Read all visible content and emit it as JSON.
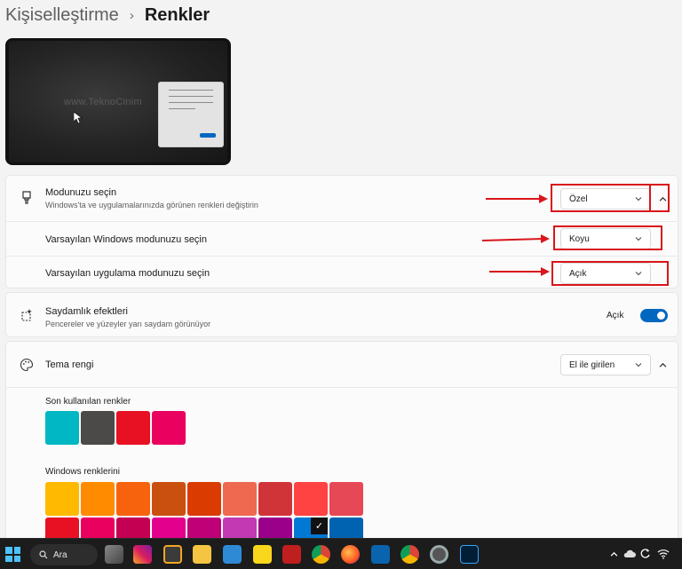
{
  "breadcrumb": {
    "parent": "Kişiselleştirme",
    "separator": "›",
    "current": "Renkler"
  },
  "preview": {
    "watermark": "www.TeknoCinim"
  },
  "mode_card": {
    "main": {
      "title": "Modunuzu seçin",
      "subtitle": "Windows'ta ve uygulamalarınızda görünen renkleri değiştirin",
      "value": "Özel",
      "icon": "paintbrush-icon"
    },
    "windows_mode": {
      "title": "Varsayılan Windows modunuzu seçin",
      "value": "Koyu"
    },
    "app_mode": {
      "title": "Varsayılan uygulama modunuzu seçin",
      "value": "Açık"
    }
  },
  "transparency": {
    "title": "Saydamlık efektleri",
    "subtitle": "Pencereler ve yüzeyler yarı saydam görünüyor",
    "toggle_label": "Açık",
    "on": true,
    "icon": "transparency-icon"
  },
  "accent": {
    "title": "Tema rengi",
    "value": "El ile girilen",
    "icon": "palette-icon",
    "recent_label": "Son kullanılan renkler",
    "recent_colors": [
      "#00b7c3",
      "#4c4a48",
      "#e81123",
      "#ea005e"
    ],
    "windows_label": "Windows renklerini",
    "windows_colors_row1": [
      "#ffb900",
      "#ff8c00",
      "#f7630c",
      "#ca5010",
      "#da3b01",
      "#ef6950",
      "#d13438",
      "#ff4343",
      "#e74856"
    ],
    "windows_colors_row2": [
      "#e81123",
      "#ea005e",
      "#c30052",
      "#e3008c",
      "#bf0077",
      "#c239b3",
      "#9a0089",
      "#0078d4",
      "#0063b1"
    ],
    "selected_index_row2": 7
  },
  "taskbar": {
    "search_label": "Ara",
    "apps": [
      "task-view-icon",
      "instagram-icon",
      "sublime-icon",
      "file-explorer-icon",
      "mail-icon",
      "sticky-notes-icon",
      "filezilla-icon",
      "chrome-icon",
      "firefox-icon",
      "outlook-icon",
      "chrome-profile-icon",
      "settings-icon",
      "photoshop-icon"
    ],
    "tray": [
      "chevron-up-icon",
      "cloud-icon",
      "sync-icon",
      "wifi-icon"
    ]
  },
  "annotation_color": "#d9151b",
  "accent_color": "#0067c0"
}
